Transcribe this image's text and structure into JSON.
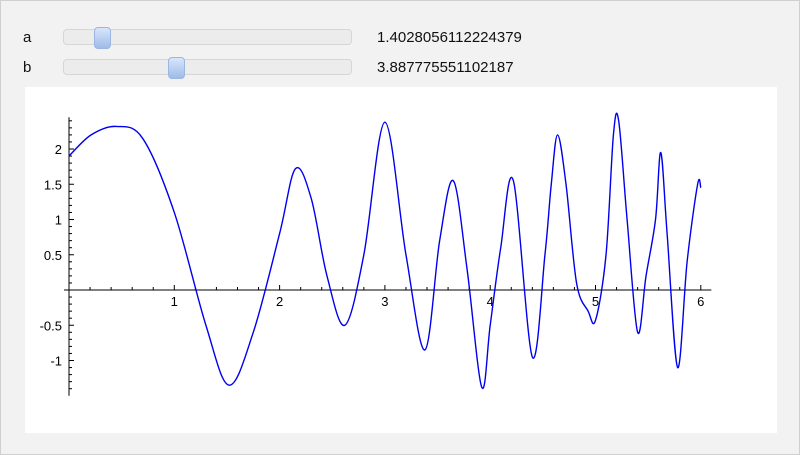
{
  "controls": {
    "a": {
      "label": "a",
      "value": "1.4028056112224379"
    },
    "b": {
      "label": "b",
      "value": "3.887775551102187"
    }
  },
  "colors": {
    "curve": "#0000ee",
    "axes": "#000000",
    "slider_thumb": "#b8cdf0"
  },
  "chart_data": {
    "type": "line",
    "title": "",
    "xlabel": "",
    "ylabel": "",
    "xlim": [
      0,
      6.1
    ],
    "ylim": [
      -1.5,
      2.5
    ],
    "x_ticks": [
      "1",
      "2",
      "3",
      "4",
      "5",
      "6"
    ],
    "y_ticks": [
      "-1",
      "-0.5",
      "0.5",
      "1",
      "1.5",
      "2"
    ],
    "grid": false,
    "series": [
      {
        "x": [
          0.0,
          0.21,
          0.45,
          0.7,
          1.0,
          1.3,
          1.52,
          1.75,
          2.0,
          2.15,
          2.3,
          2.45,
          2.62,
          2.8,
          3.0,
          3.2,
          3.38,
          3.52,
          3.65,
          3.78,
          3.92,
          4.0,
          4.1,
          4.22,
          4.4,
          4.52,
          4.58,
          4.64,
          4.72,
          4.82,
          4.93,
          5.0,
          5.1,
          5.17,
          5.22,
          5.3,
          5.4,
          5.48,
          5.57,
          5.62,
          5.68,
          5.78,
          5.87,
          5.97,
          6.0
        ],
        "y": [
          1.9,
          2.2,
          2.32,
          2.15,
          1.1,
          -0.5,
          -1.35,
          -0.6,
          0.8,
          1.72,
          1.3,
          0.2,
          -0.5,
          0.5,
          2.38,
          0.5,
          -0.85,
          0.7,
          1.55,
          0.3,
          -1.38,
          -0.5,
          0.6,
          1.55,
          -0.95,
          0.5,
          1.5,
          2.2,
          1.5,
          0.1,
          -0.3,
          -0.43,
          0.5,
          2.2,
          2.4,
          1.0,
          -0.6,
          0.2,
          1.0,
          1.95,
          0.8,
          -1.1,
          0.4,
          1.5,
          1.45
        ]
      }
    ]
  }
}
